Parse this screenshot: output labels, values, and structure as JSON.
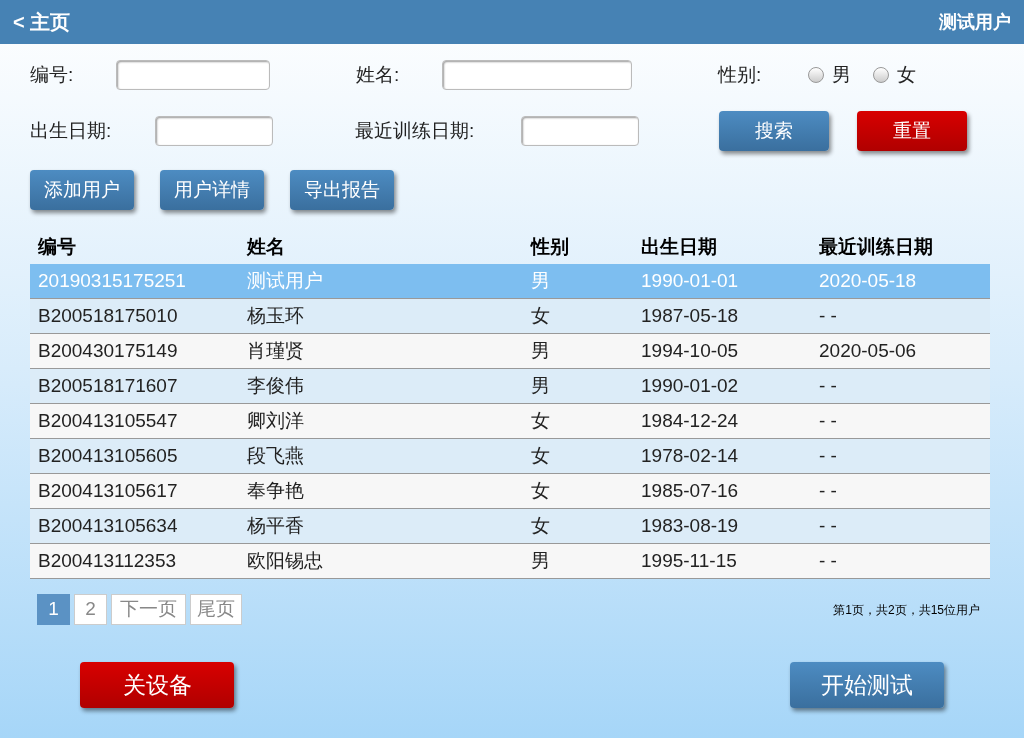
{
  "header": {
    "back": "< 主页",
    "user": "测试用户"
  },
  "filters": {
    "id_label": "编号:",
    "name_label": "姓名:",
    "gender_label": "性别:",
    "genders": [
      {
        "label": "男",
        "selected": false
      },
      {
        "label": "女",
        "selected": false
      }
    ],
    "birth_label": "出生日期:",
    "train_label": "最近训练日期:",
    "search": "搜索",
    "reset": "重置"
  },
  "actions": [
    "添加用户",
    "用户详情",
    "导出报告"
  ],
  "table": {
    "columns": [
      "编号",
      "姓名",
      "性别",
      "出生日期",
      "最近训练日期"
    ],
    "rows": [
      {
        "cells": [
          "20190315175251",
          "测试用户",
          "男",
          "1990-01-01",
          "2020-05-18"
        ],
        "selected": true
      },
      {
        "cells": [
          "B200518175010",
          "杨玉环",
          "女",
          "1987-05-18",
          "- -"
        ],
        "selected": false
      },
      {
        "cells": [
          "B200430175149",
          "肖瑾贤",
          "男",
          "1994-10-05",
          "2020-05-06"
        ],
        "selected": false
      },
      {
        "cells": [
          "B200518171607",
          "李俊伟",
          "男",
          "1990-01-02",
          "- -"
        ],
        "selected": false
      },
      {
        "cells": [
          "B200413105547",
          "卿刘洋",
          "女",
          "1984-12-24",
          "- -"
        ],
        "selected": false
      },
      {
        "cells": [
          "B200413105605",
          "段飞燕",
          "女",
          "1978-02-14",
          "- -"
        ],
        "selected": false
      },
      {
        "cells": [
          "B200413105617",
          "奉争艳",
          "女",
          "1985-07-16",
          "- -"
        ],
        "selected": false
      },
      {
        "cells": [
          "B200413105634",
          "杨平香",
          "女",
          "1983-08-19",
          "- -"
        ],
        "selected": false
      },
      {
        "cells": [
          "B200413112353",
          "欧阳锡忠",
          "男",
          "1995-11-15",
          "- -"
        ],
        "selected": false
      }
    ]
  },
  "pagination": {
    "pages": [
      {
        "label": "1",
        "selected": true
      },
      {
        "label": "2",
        "selected": false
      }
    ],
    "next": "下一页",
    "last": "尾页",
    "summary": "第1页，共2页，共15位用户"
  },
  "footer": {
    "power_off": "关设备",
    "start": "开始测试"
  }
}
